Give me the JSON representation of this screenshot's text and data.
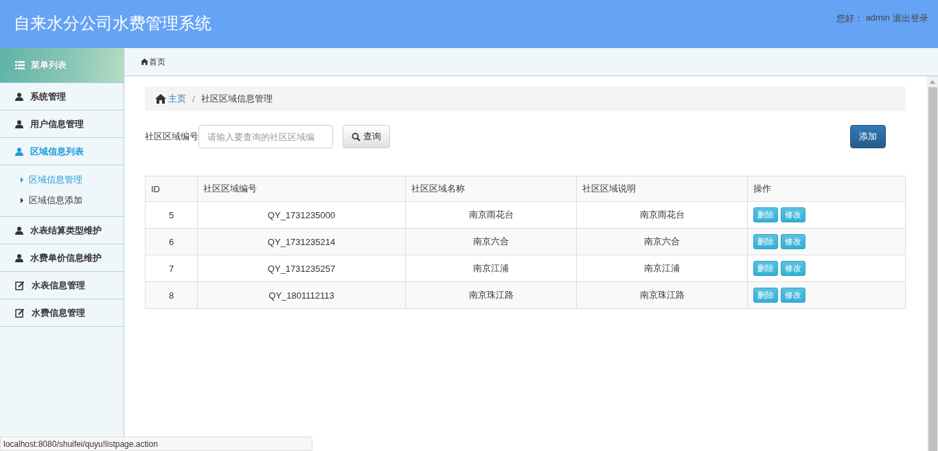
{
  "header": {
    "title": "自来水分公司水费管理系统",
    "greeting": "您好：",
    "user": "admin",
    "logout": "退出登录"
  },
  "sidebar": {
    "title": "菜单列表",
    "items": [
      {
        "label": "系统管理",
        "kind": "user",
        "selected": false
      },
      {
        "label": "用户信息管理",
        "kind": "user",
        "selected": false
      },
      {
        "label": "区域信息列表",
        "kind": "user",
        "selected": true,
        "children": [
          {
            "label": "区域信息管理",
            "selected": true
          },
          {
            "label": "区域信息添加",
            "selected": false
          }
        ]
      },
      {
        "label": "水表结算类型维护",
        "kind": "user",
        "selected": false
      },
      {
        "label": "水费单价信息维护",
        "kind": "user",
        "selected": false
      },
      {
        "label": "水表信息管理",
        "kind": "edit",
        "selected": false
      },
      {
        "label": "水费信息管理",
        "kind": "edit",
        "selected": false
      }
    ]
  },
  "tabs": [
    {
      "label": "首页"
    }
  ],
  "breadcrumb": {
    "home": "主页",
    "separator": "/",
    "current": "社区区域信息管理"
  },
  "search": {
    "label": "社区区域编号",
    "placeholder": "请输入要查询的社区区域编",
    "button": "查询",
    "add_button": "添加"
  },
  "table": {
    "columns": [
      "ID",
      "社区区域编号",
      "社区区域名称",
      "社区区域说明",
      "操作"
    ],
    "rows": [
      {
        "id": "5",
        "code": "QY_1731235000",
        "name": "南京雨花台",
        "desc": "南京雨花台",
        "actions": [
          "删除",
          "修改"
        ]
      },
      {
        "id": "6",
        "code": "QY_1731235214",
        "name": "南京六合",
        "desc": "南京六合",
        "actions": [
          "删除",
          "修改"
        ]
      },
      {
        "id": "7",
        "code": "QY_1731235257",
        "name": "南京江浦",
        "desc": "南京江浦",
        "actions": [
          "删除",
          "修改"
        ]
      },
      {
        "id": "8",
        "code": "QY_1801112113",
        "name": "南京珠江路",
        "desc": "南京珠江路",
        "actions": [
          "删除",
          "修改"
        ]
      }
    ]
  },
  "status_bar": {
    "url": "localhost:8080/shuifei/quyu!listpage.action"
  }
}
